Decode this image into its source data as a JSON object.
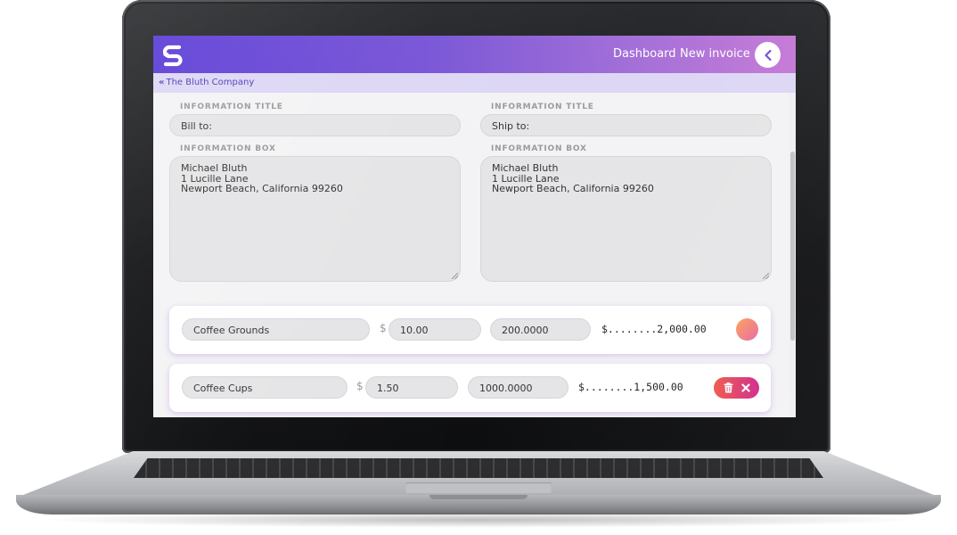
{
  "brand": {
    "logo_icon": "s-logo-icon",
    "accent_gradient": [
      "#5a3bd6",
      "#c57ad6"
    ]
  },
  "nav": {
    "dashboard_label": "Dashboard",
    "new_invoice_label": "New invoice",
    "back_icon": "chevron-left-icon"
  },
  "breadcrumb": {
    "icon": "double-chevron-left-icon",
    "label": "The Bluth Company"
  },
  "bill_to": {
    "title_label": "INFORMATION TITLE",
    "title_value": "Bill to:",
    "box_label": "INFORMATION BOX",
    "box_lines": [
      "Michael Bluth",
      "1 Lucille Lane",
      "Newport Beach, California 99260"
    ]
  },
  "ship_to": {
    "title_label": "INFORMATION TITLE",
    "title_value": "Ship to:",
    "box_label": "INFORMATION BOX",
    "box_lines": [
      "Michael Bluth",
      "1 Lucille Lane",
      "Newport Beach, California 99260"
    ]
  },
  "line_items": [
    {
      "description": "Coffee Grounds",
      "currency": "$",
      "price": "10.00",
      "quantity": "200.0000",
      "total": "$........2,000.00",
      "action": "gradient-orb"
    },
    {
      "description": "Coffee Cups",
      "currency": "$",
      "price": "1.50",
      "quantity": "1000.0000",
      "total": "$........1,500.00",
      "actions": [
        "trash-icon",
        "close-icon"
      ]
    }
  ]
}
